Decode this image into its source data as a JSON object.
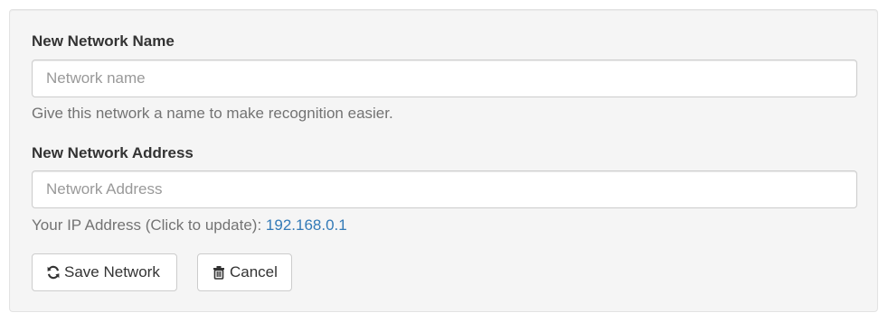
{
  "form": {
    "name_field": {
      "label": "New Network Name",
      "placeholder": "Network name",
      "value": "",
      "help": "Give this network a name to make recognition easier."
    },
    "address_field": {
      "label": "New Network Address",
      "placeholder": "Network Address",
      "value": "",
      "help_prefix": "Your IP Address (Click to update): ",
      "ip_address": "192.168.0.1"
    },
    "buttons": {
      "save": {
        "label": "Save Network",
        "icon": "refresh-icon"
      },
      "cancel": {
        "label": "Cancel",
        "icon": "trash-icon"
      }
    }
  },
  "colors": {
    "panel_bg": "#f5f5f5",
    "link": "#337ab7",
    "help_text": "#737373"
  }
}
